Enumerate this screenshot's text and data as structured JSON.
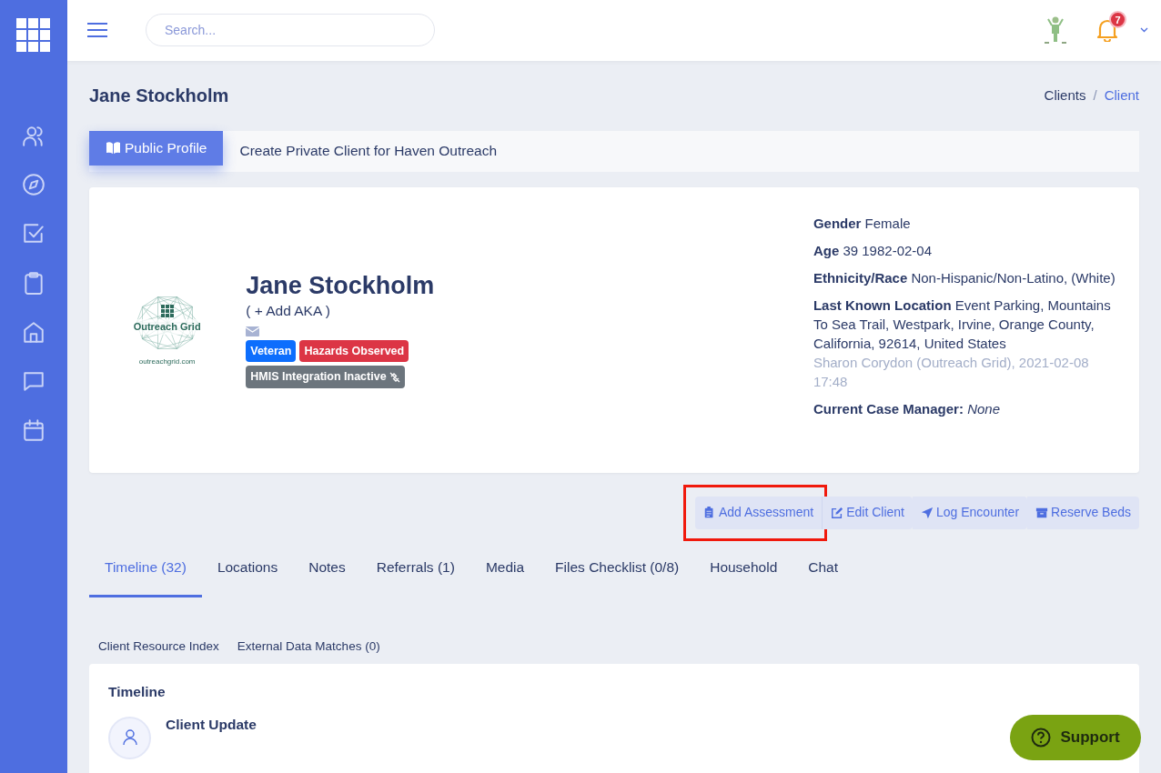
{
  "topbar": {
    "search": {
      "placeholder": "Search..."
    },
    "notifications": {
      "count": "7"
    }
  },
  "page_title": "Jane Stockholm",
  "breadcrumb": {
    "separator": "/",
    "items": [
      {
        "label": "Clients",
        "current": false
      },
      {
        "label": "Client",
        "current": true
      }
    ]
  },
  "profile_tabs": [
    {
      "label": "Public Profile",
      "selected": true
    },
    {
      "label": "Create Private Client for Haven Outreach",
      "selected": false
    }
  ],
  "client": {
    "logo": {
      "name": "Outreach Grid",
      "url": "outreachgrid.com"
    },
    "name": "Jane Stockholm",
    "aka": "( + Add AKA )",
    "badges": [
      {
        "label": "Veteran",
        "color": "#0d6efd"
      },
      {
        "label": "Hazards Observed",
        "color": "#dc3545"
      },
      {
        "label": "HMIS Integration Inactive",
        "color": "#6c757d"
      }
    ],
    "details": [
      {
        "label": "Gender",
        "value": "Female"
      },
      {
        "label": "Age",
        "value": "39 1982-02-04"
      },
      {
        "label": "Ethnicity/Race",
        "value": "Non-Hispanic/Non-Latino, (White)"
      },
      {
        "label": "Last Known Location",
        "value": "Event Parking, Mountains To Sea Trail, Westpark, Irvine, Orange County, California, 92614, United States",
        "note": "Sharon Corydon (Outreach Grid), 2021-02-08 17:48"
      }
    ],
    "case_manager": {
      "label": "Current Case Manager:",
      "value": "None"
    }
  },
  "actions": [
    {
      "label": "Add Assessment",
      "highlighted": true
    },
    {
      "label": "Edit Client",
      "highlighted": false
    },
    {
      "label": "Log Encounter",
      "highlighted": false
    },
    {
      "label": "Reserve Beds",
      "highlighted": false
    }
  ],
  "tabs": [
    {
      "label": "Timeline (32)",
      "selected": true
    },
    {
      "label": "Locations",
      "selected": false
    },
    {
      "label": "Notes",
      "selected": false
    },
    {
      "label": "Referrals (1)",
      "selected": false
    },
    {
      "label": "Media",
      "selected": false
    },
    {
      "label": "Files Checklist (0/8)",
      "selected": false
    },
    {
      "label": "Household",
      "selected": false
    },
    {
      "label": "Chat",
      "selected": false
    }
  ],
  "subtabs": [
    {
      "label": "Client Resource Index"
    },
    {
      "label": "External Data Matches (0)"
    }
  ],
  "timeline": {
    "title": "Timeline",
    "entries": [
      {
        "title": "Client Update"
      }
    ]
  },
  "support": {
    "label": "Support"
  }
}
